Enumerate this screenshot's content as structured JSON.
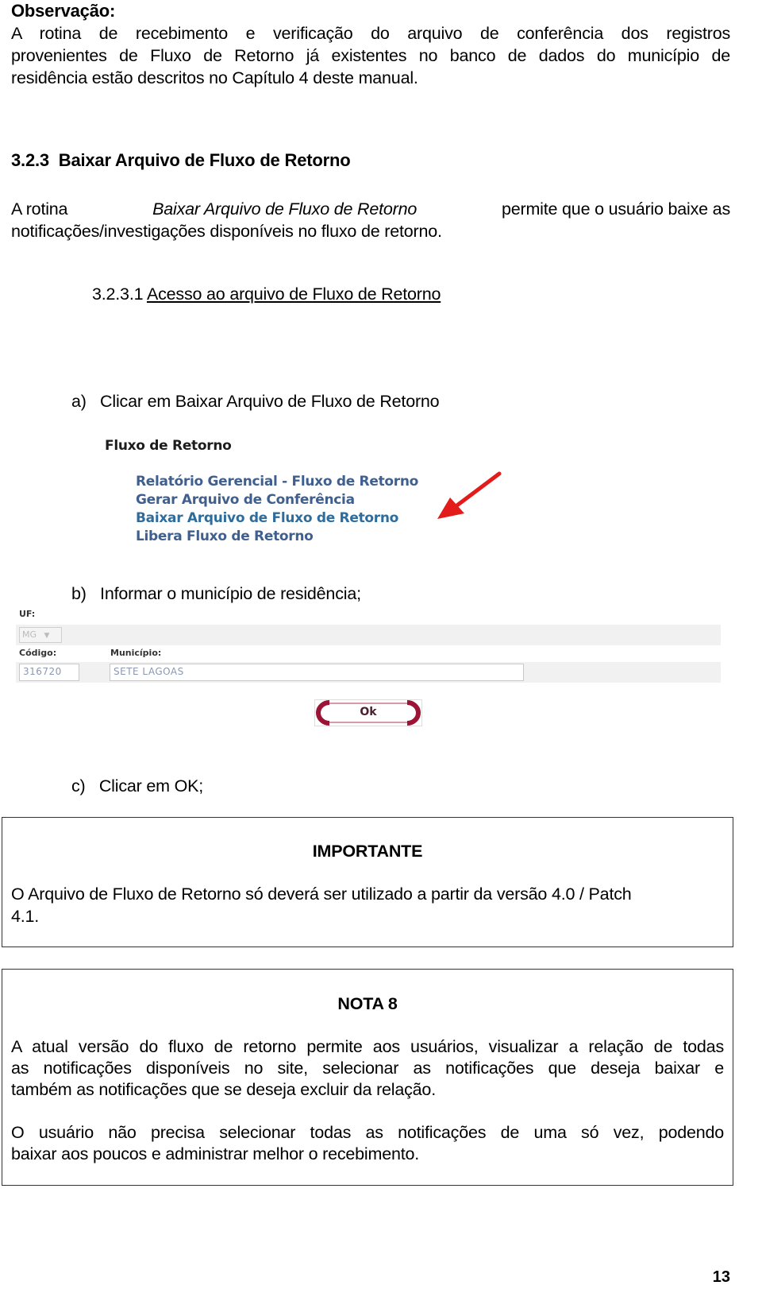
{
  "observation": {
    "title": "Observação:",
    "lines": [
      "A rotina de recebimento e verificação do arquivo de conferência dos registros",
      "provenientes de Fluxo de Retorno já existentes no banco de dados do município de",
      "residência estão descritos no Capítulo 4 deste manual."
    ]
  },
  "section": {
    "number": "3.2.3",
    "title": "Baixar Arquivo de Fluxo de Retorno",
    "intro_prefix": "A rotina",
    "intro_italic": "Baixar Arquivo de Fluxo de Retorno",
    "intro_suffix": "permite que o usuário baixe as",
    "intro_line2": "notificações/investigações disponíveis no fluxo de retorno."
  },
  "subsection": {
    "number": "3.2.3.1",
    "title": "Acesso ao arquivo de Fluxo de Retorno"
  },
  "steps": [
    {
      "marker": "a)",
      "text": "Clicar em Baixar Arquivo de Fluxo de Retorno"
    },
    {
      "marker": "b)",
      "text": "Informar o município de residência;"
    },
    {
      "marker": "c)",
      "text": "Clicar em OK;"
    }
  ],
  "menu_screenshot": {
    "heading": "Fluxo de Retorno",
    "items": [
      "Relatório Gerencial - Fluxo de Retorno",
      "Gerar Arquivo de Conferência",
      "Baixar Arquivo de Fluxo de Retorno",
      "Libera Fluxo de Retorno"
    ],
    "highlighted_index": 2,
    "arrow_color": "#e31b1b"
  },
  "form_screenshot": {
    "uf_label": "UF:",
    "uf_value": "MG",
    "codigo_label": "Código:",
    "codigo_value": "316720",
    "municipio_label": "Município:",
    "municipio_value": "SETE LAGOAS",
    "ok_label": "Ok",
    "ok_color": "#9b1435"
  },
  "important_box": {
    "title": "IMPORTANTE",
    "text_line1": "O Arquivo de Fluxo de Retorno só deverá ser utilizado a partir da versão 4.0 / Patch",
    "text_line2": "4.1."
  },
  "note_box": {
    "title": "NOTA 8",
    "para1": [
      "A atual versão do fluxo de retorno permite aos usuários, visualizar a relação de todas",
      "as notificações disponíveis no site, selecionar as notificações que deseja baixar e",
      "também as notificações que se deseja excluir da relação."
    ],
    "para2": [
      "O usuário não precisa selecionar todas as notificações de uma só vez, podendo",
      "baixar aos poucos e administrar melhor o recebimento."
    ]
  },
  "page_number": "13"
}
